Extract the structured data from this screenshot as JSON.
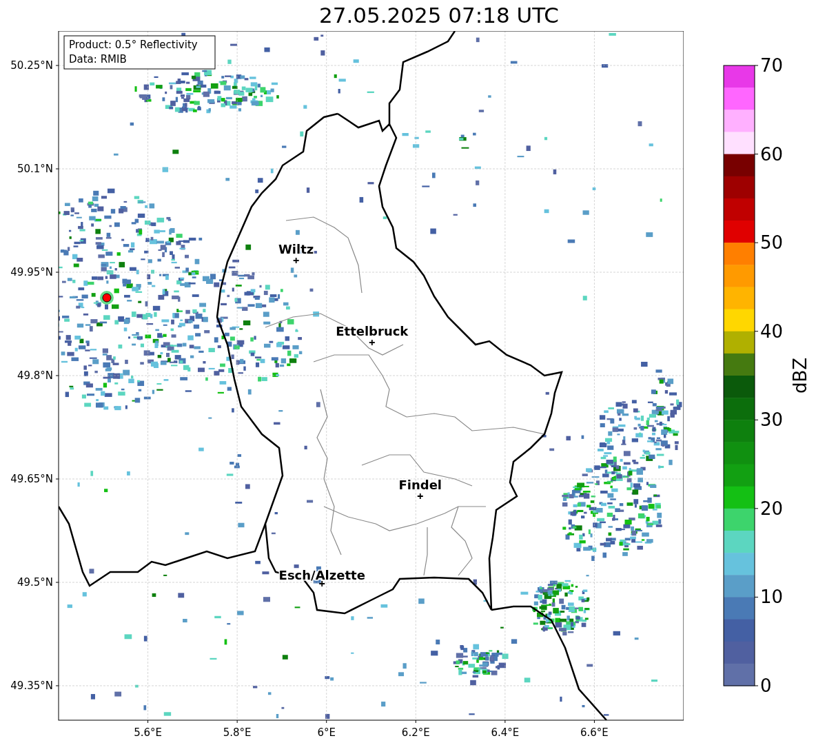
{
  "title": "27.05.2025 07:18 UTC",
  "info_box": {
    "lines": [
      "Product: 0.5° Reflectivity",
      "Data: RMIB"
    ]
  },
  "map": {
    "lon_labels": [
      "5.6°E",
      "5.8°E",
      "6°E",
      "6.2°E",
      "6.4°E",
      "6.6°E"
    ],
    "lat_labels": [
      "50.25°N",
      "50.1°N",
      "49.95°N",
      "49.8°N",
      "49.65°N",
      "49.5°N",
      "49.35°N"
    ],
    "places": [
      {
        "name": "Wiltz"
      },
      {
        "name": "Ettelbruck"
      },
      {
        "name": "Findel"
      },
      {
        "name": "Esch/Alzette"
      }
    ]
  },
  "colorbar": {
    "label": "dBZ",
    "ticks": [
      "70",
      "60",
      "50",
      "40",
      "30",
      "20",
      "10",
      "0"
    ],
    "bins": [
      {
        "color": "#e838e8"
      },
      {
        "color": "#ff66ff"
      },
      {
        "color": "#ffb0ff"
      },
      {
        "color": "#ffe0ff"
      },
      {
        "color": "#780000"
      },
      {
        "color": "#9e0000"
      },
      {
        "color": "#c00000"
      },
      {
        "color": "#e00000"
      },
      {
        "color": "#ff7f00"
      },
      {
        "color": "#ff9a00"
      },
      {
        "color": "#ffb400"
      },
      {
        "color": "#ffd700"
      },
      {
        "color": "#b0b000"
      },
      {
        "color": "#457a10"
      },
      {
        "color": "#0b5a0b"
      },
      {
        "color": "#0c6e0c"
      },
      {
        "color": "#0e800e"
      },
      {
        "color": "#109010"
      },
      {
        "color": "#12a012"
      },
      {
        "color": "#14c014"
      },
      {
        "color": "#3dd46c"
      },
      {
        "color": "#5cd6c0"
      },
      {
        "color": "#66c2dd"
      },
      {
        "color": "#5a9ec8"
      },
      {
        "color": "#4a7ab5"
      },
      {
        "color": "#4460a4"
      },
      {
        "color": "#5060a0"
      },
      {
        "color": "#6070a8"
      }
    ]
  }
}
